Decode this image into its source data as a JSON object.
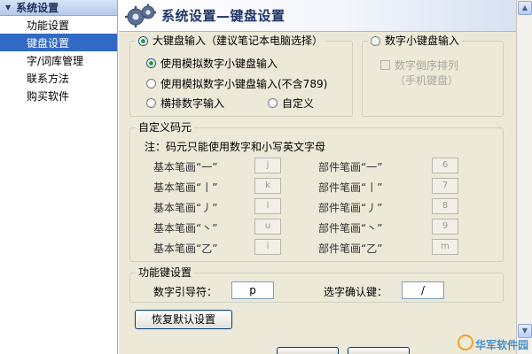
{
  "sidebar": {
    "header": "系统设置",
    "items": [
      {
        "label": "功能设置",
        "active": false
      },
      {
        "label": "键盘设置",
        "active": true
      },
      {
        "label": "字/词库管理",
        "active": false
      },
      {
        "label": "联系方法",
        "active": false
      },
      {
        "label": "购买软件",
        "active": false
      }
    ]
  },
  "header": {
    "title": "系统设置—键盘设置",
    "icon": "gear-icon"
  },
  "keyboard_group": {
    "legend": "大键盘输入（建议笔记本电脑选择）",
    "options": [
      "使用模拟数字小键盘输入",
      "使用模拟数字小键盘输入(不含789)",
      "横排数字输入",
      "自定义"
    ],
    "selected": 0
  },
  "numpad_group": {
    "legend": "数字小键盘输入",
    "checkbox_line1": "数字倒序排列",
    "checkbox_line2": "（手机键盘）"
  },
  "custom_group": {
    "legend": "自定义码元",
    "note": "注：码元只能使用数字和小写英文字母",
    "left": [
      {
        "label": "基本笔画“一”",
        "value": "j"
      },
      {
        "label": "基本笔画“丨”",
        "value": "k"
      },
      {
        "label": "基本笔画“丿”",
        "value": "l"
      },
      {
        "label": "基本笔画“丶”",
        "value": "u"
      },
      {
        "label": "基本笔画“乙”",
        "value": "i"
      }
    ],
    "right": [
      {
        "label": "部件笔画“一”",
        "value": "6"
      },
      {
        "label": "部件笔画“丨”",
        "value": "7"
      },
      {
        "label": "部件笔画“丿”",
        "value": "8"
      },
      {
        "label": "部件笔画“丶”",
        "value": "9"
      },
      {
        "label": "部件笔画“乙”",
        "value": "m"
      }
    ]
  },
  "function_keys": {
    "legend": "功能键设置",
    "guide_label": "数字引导符：",
    "guide_value": "p",
    "confirm_label": "选字确认键：",
    "confirm_value": "/"
  },
  "buttons": {
    "restore": "恢复默认设置"
  },
  "watermark": {
    "text": "华军软件园"
  },
  "colors": {
    "selection": "#316ac5",
    "panel_bg": "#ece9d8",
    "title": "#1e3766",
    "radio_dot": "#21a121"
  }
}
